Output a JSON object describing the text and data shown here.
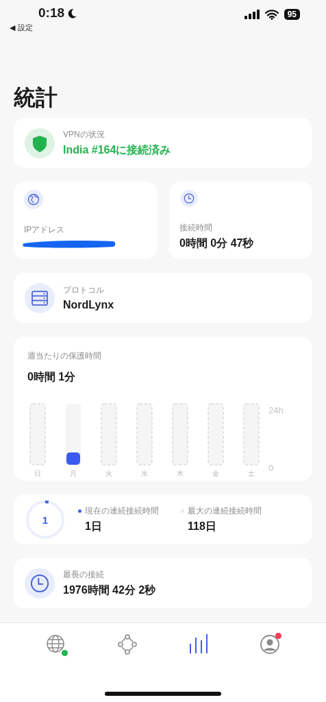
{
  "status_bar": {
    "time": "0:18",
    "back": "◀ 設定",
    "battery": "95"
  },
  "title": "統計",
  "vpn_status": {
    "label": "VPNの状況",
    "value": "India #164に接続済み"
  },
  "ip": {
    "label": "IPアドレス"
  },
  "connection_time": {
    "label": "接続時間",
    "value": "0時間 0分 47秒"
  },
  "protocol": {
    "label": "プロトコル",
    "value": "NordLynx"
  },
  "weekly": {
    "label": "週当たりの保護時間",
    "value": "0時間 1分",
    "chart_data": {
      "type": "bar",
      "categories": [
        "日",
        "月",
        "火",
        "水",
        "木",
        "金",
        "土"
      ],
      "values": [
        null,
        0.02,
        null,
        null,
        null,
        null,
        null
      ],
      "ylim": [
        0,
        24
      ],
      "yticks": [
        {
          "value": 0,
          "label": "0"
        },
        {
          "value": 24,
          "label": "24h"
        }
      ]
    }
  },
  "streak": {
    "ring_value": "1",
    "level": 0.03,
    "items": [
      {
        "label": "現在の連続接続時間",
        "value": "1日",
        "color": "#3f5fe0"
      },
      {
        "label": "最大の連続接続時間",
        "value": "118日",
        "color": "#e9ebf2"
      }
    ]
  },
  "longest": {
    "label": "最長の接続",
    "value": "1976時間 42分 2秒"
  },
  "tabs": [
    {
      "kind": "globe",
      "selected": false,
      "color": "#22b550"
    },
    {
      "kind": "nodes",
      "selected": false
    },
    {
      "kind": "stats",
      "selected": true
    },
    {
      "kind": "profile",
      "selected": false,
      "color": "#ef4056"
    }
  ]
}
